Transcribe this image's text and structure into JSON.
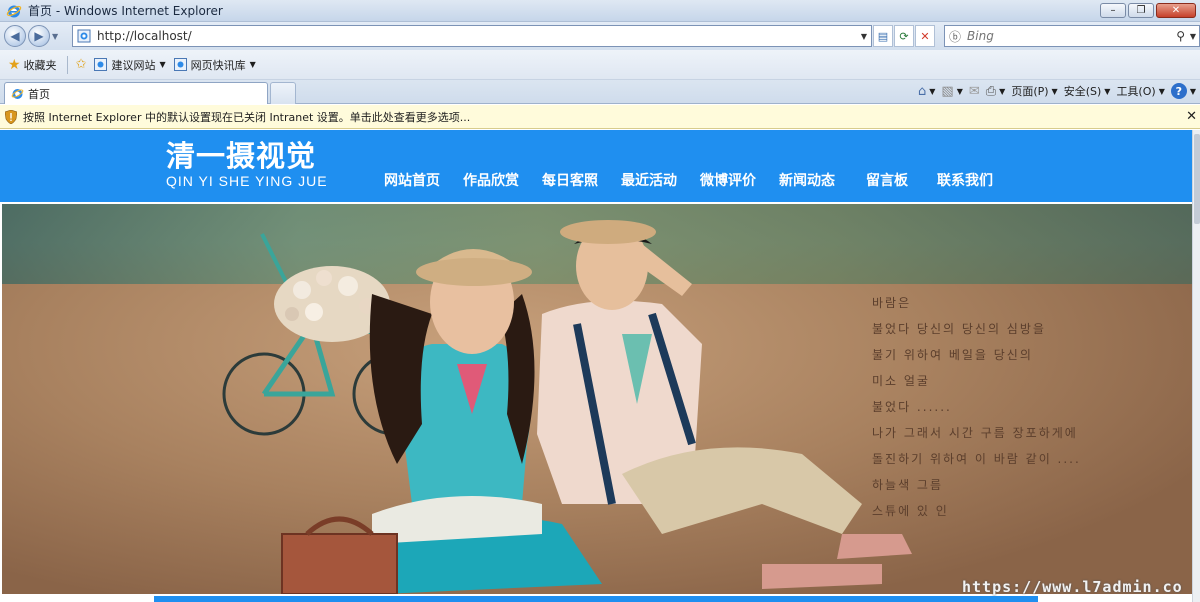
{
  "window": {
    "title": "首页 - Windows Internet Explorer",
    "minimize_label": "–",
    "restore_label": "❐",
    "close_label": "✕"
  },
  "address_bar": {
    "url": "http://localhost/",
    "search_placeholder": "Bing"
  },
  "favorites_bar": {
    "favorites_label": "收藏夹",
    "links": [
      {
        "label": "建议网站"
      },
      {
        "label": "网页快讯库"
      }
    ]
  },
  "tabs": [
    {
      "label": "首页"
    }
  ],
  "command_bar": {
    "page_label": "页面(P)",
    "safety_label": "安全(S)",
    "tools_label": "工具(O)",
    "help_label": "?"
  },
  "info_bar": {
    "message": "按照 Internet Explorer 中的默认设置现在已关闭 Intranet 设置。单击此处查看更多选项...",
    "close_label": "✕"
  },
  "site": {
    "logo_cn": "清一摄视觉",
    "logo_en": "QIN YI SHE YING JUE",
    "nav": [
      {
        "label": "网站首页"
      },
      {
        "label": "作品欣赏"
      },
      {
        "label": "每日客照"
      },
      {
        "label": "最近活动"
      },
      {
        "label": "微博评价"
      },
      {
        "label": "新闻动态"
      },
      {
        "label": "留言板"
      },
      {
        "label": "联系我们"
      }
    ],
    "poem": [
      "바람은",
      "불었다 당신의 당신의 심방을",
      "불기 위하여 베일을 당신의",
      "미소 얼굴",
      "불었다 ......",
      "나가 그래서 시간 구름 장포하게에",
      "돌진하기 위하여 이 바람 같이 ....",
      "하늘색 그름",
      "스튜에 있 인"
    ],
    "watermark": "https://www.l7admin.co"
  },
  "colors": {
    "brand_blue": "#1f8ff0",
    "info_bar_bg": "#fffbdb"
  }
}
